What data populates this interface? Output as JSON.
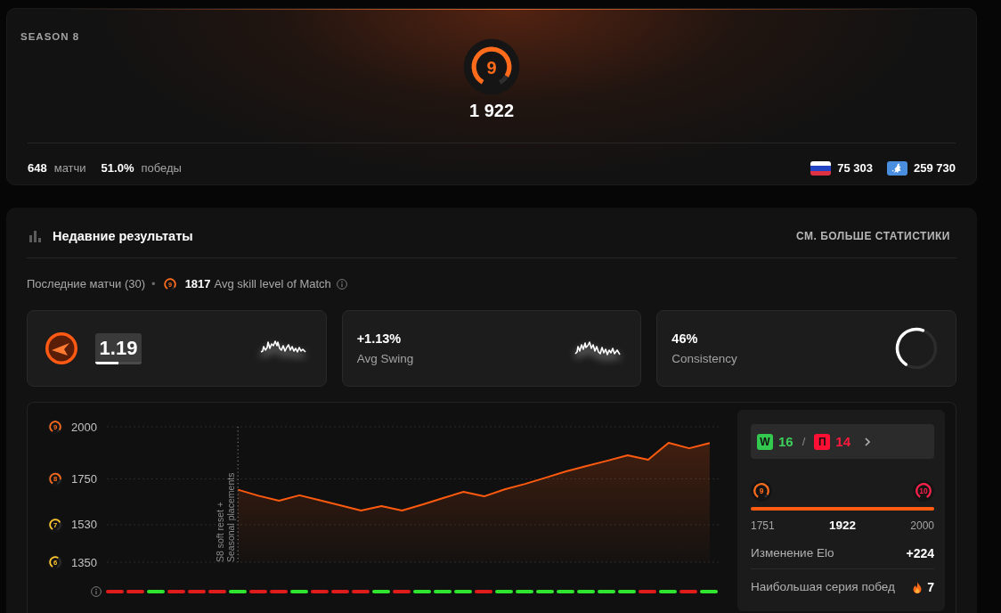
{
  "season": {
    "title": "SEASON 8",
    "skill": {
      "label": "9",
      "level": 0.9
    },
    "elo": "1 922",
    "stats": [
      {
        "value": "648",
        "unit": "матчи"
      },
      {
        "value": "51.0%",
        "unit": "победы"
      }
    ],
    "rankings": [
      {
        "kind": "country",
        "value": "75 303"
      },
      {
        "kind": "region",
        "value": "259 730"
      }
    ]
  },
  "recent": {
    "title": "Недавние результаты",
    "link": "СМ. БОЛЬШЕ СТАТИСТИКИ",
    "summary": {
      "label": "Последние матчи (30)",
      "separator": "•",
      "skill": {
        "label": "9",
        "level": 0.9
      },
      "value": "1817",
      "caption": "Avg skill level of Match"
    },
    "cards": [
      {
        "kind": "rating",
        "value": "1.19",
        "level": 0.5
      },
      {
        "kind": "trend",
        "value": "+1.13%",
        "label": "Avg Swing"
      },
      {
        "kind": "ring",
        "value": "46%",
        "label": "Consistency",
        "level": 0.46
      }
    ],
    "chart": {
      "chart_data": {
        "type": "area",
        "categories": [
          null,
          null,
          null,
          null,
          null,
          null,
          null,
          null,
          null,
          null,
          null,
          null,
          null,
          null,
          null,
          null,
          null,
          null,
          null,
          null,
          null,
          null,
          null,
          null
        ],
        "values": [
          1698,
          1669,
          1645,
          1671,
          1647,
          1623,
          1598,
          1619,
          1598,
          1627,
          1658,
          1688,
          1666,
          1700,
          1726,
          1756,
          1786,
          1812,
          1837,
          1863,
          1842,
          1923,
          1897,
          1922
        ],
        "ylim": [
          1350,
          2000
        ],
        "yticks": [
          {
            "value": 2000,
            "label": "2000"
          },
          {
            "value": 1750,
            "label": "1750"
          },
          {
            "value": 1530,
            "label": "1530"
          },
          {
            "value": 1350,
            "label": "1350"
          }
        ],
        "annotations": [
          {
            "text": "S8 soft reset +"
          },
          {
            "text": "Seasonal placements"
          }
        ]
      },
      "axis_badges": [
        {
          "label": "9",
          "level": 0.9,
          "color": "#ff6b1a"
        },
        {
          "label": "8",
          "level": 0.8,
          "color": "#ff6b1a"
        },
        {
          "label": "7",
          "level": 0.7,
          "color": "#ffc72c"
        },
        {
          "label": "6",
          "level": 0.6,
          "color": "#ffc72c"
        }
      ],
      "results": [
        {
          "color": "#e01b1b"
        },
        {
          "color": "#e01b1b"
        },
        {
          "color": "#2fe42f"
        },
        {
          "color": "#e01b1b"
        },
        {
          "color": "#e01b1b"
        },
        {
          "color": "#e01b1b"
        },
        {
          "color": "#2fe42f"
        },
        {
          "color": "#e01b1b"
        },
        {
          "color": "#e01b1b"
        },
        {
          "color": "#2fe42f"
        },
        {
          "color": "#e01b1b"
        },
        {
          "color": "#e01b1b"
        },
        {
          "color": "#e01b1b"
        },
        {
          "color": "#2fe42f"
        },
        {
          "color": "#e01b1b"
        },
        {
          "color": "#2fe42f"
        },
        {
          "color": "#2fe42f"
        },
        {
          "color": "#2fe42f"
        },
        {
          "color": "#e01b1b"
        },
        {
          "color": "#2fe42f"
        },
        {
          "color": "#2fe42f"
        },
        {
          "color": "#2fe42f"
        },
        {
          "color": "#2fe42f"
        },
        {
          "color": "#2fe42f"
        },
        {
          "color": "#2fe42f"
        },
        {
          "color": "#2fe42f"
        },
        {
          "color": "#e01b1b"
        },
        {
          "color": "#2fe42f"
        },
        {
          "color": "#e01b1b"
        },
        {
          "color": "#2fe42f"
        }
      ]
    },
    "panel": {
      "wins": {
        "badge": "W",
        "count": "16"
      },
      "separator": "/",
      "losses": {
        "badge": "П",
        "count": "14"
      },
      "range": {
        "badges": [
          {
            "label": "9",
            "level": 0.9,
            "color": "#ff6b1a"
          },
          {
            "label": "10",
            "level": 1,
            "color": "#ff1f4b"
          }
        ],
        "level": 1,
        "min": "1751",
        "current": "1922",
        "max": "2000"
      },
      "rows": [
        {
          "kind": "plain",
          "label": "Изменение Elo",
          "value": "+224"
        },
        {
          "kind": "streak",
          "label": "Наибольшая серия побед",
          "value": "7"
        }
      ]
    }
  }
}
